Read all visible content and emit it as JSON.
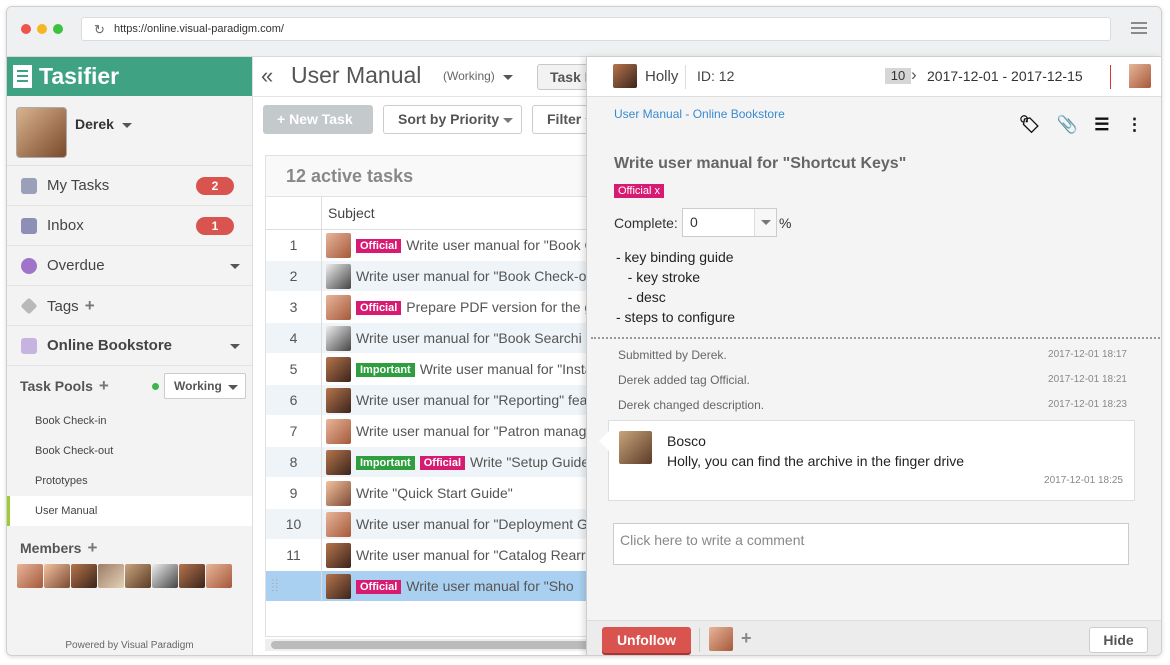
{
  "browser": {
    "url": "https://online.visual-paradigm.com/"
  },
  "sidebar": {
    "brand": "Tasifier",
    "user_name": "Derek",
    "items": [
      {
        "label": "My Tasks",
        "badge": "2",
        "icon": "my-tasks-icon"
      },
      {
        "label": "Inbox",
        "badge": "1",
        "icon": "inbox-icon"
      },
      {
        "label": "Overdue",
        "icon": "overdue-icon"
      },
      {
        "label": "Tags",
        "icon": "tag-icon"
      },
      {
        "label": "Online Bookstore",
        "icon": "project-icon"
      }
    ],
    "pools_label": "Task Pools",
    "pool_status": "Working",
    "pools": [
      "Book Check-in",
      "Book Check-out",
      "Prototypes",
      "User Manual"
    ],
    "active_pool": "User Manual",
    "members_label": "Members",
    "powered_by": "Powered by Visual Paradigm"
  },
  "main": {
    "title": "User Manual",
    "status": "(Working)",
    "task_button": "Task B",
    "new_task": "New Task",
    "sort": "Sort by Priority",
    "filter": "Filter",
    "active_count": "12 active tasks",
    "subject_header": "Subject",
    "rows": [
      {
        "num": "1",
        "tags": [
          "Official"
        ],
        "text": "Write user manual for \"Book C"
      },
      {
        "num": "2",
        "tags": [],
        "text": "Write user manual for \"Book Check-o"
      },
      {
        "num": "3",
        "tags": [
          "Official"
        ],
        "text": "Prepare PDF version for the g"
      },
      {
        "num": "4",
        "tags": [],
        "text": "Write user manual for \"Book Searchi"
      },
      {
        "num": "5",
        "tags": [
          "Important"
        ],
        "text": "Write user manual for \"Insta"
      },
      {
        "num": "6",
        "tags": [],
        "text": "Write user manual for \"Reporting\" fea"
      },
      {
        "num": "7",
        "tags": [],
        "text": "Write user manual for \"Patron manag"
      },
      {
        "num": "8",
        "tags": [
          "Important",
          "Official"
        ],
        "text": "Write \"Setup Guide"
      },
      {
        "num": "9",
        "tags": [],
        "text": "Write \"Quick Start Guide\""
      },
      {
        "num": "10",
        "tags": [],
        "text": "Write user manual for \"Deployment G"
      },
      {
        "num": "11",
        "tags": [],
        "text": "Write user manual for \"Catalog Rearr"
      },
      {
        "num": "",
        "tags": [
          "Official"
        ],
        "text": "Write user manual for \"Sho"
      }
    ]
  },
  "detail": {
    "assignee": "Holly",
    "id": "ID: 12",
    "priority": "10",
    "dates": "2017-12-01 - 2017-12-15",
    "breadcrumb": "User Manual - Online Bookstore",
    "title": "Write user manual for \"Shortcut Keys\"",
    "tag": "Official  x",
    "complete_label": "Complete:",
    "complete_value": "0",
    "percent": "%",
    "description": "- key binding guide\n   - key stroke\n   - desc\n- steps to configure",
    "log": [
      {
        "text": "Submitted by Derek.",
        "time": "2017-12-01 18:17"
      },
      {
        "text": "Derek added tag Official.",
        "time": "2017-12-01 18:21"
      },
      {
        "text": "Derek changed description.",
        "time": "2017-12-01 18:23"
      }
    ],
    "comment": {
      "author": "Bosco",
      "text": "Holly, you can find the archive in the finger drive",
      "time": "2017-12-01 18:25"
    },
    "comment_placeholder": "Click here to write a comment",
    "unfollow": "Unfollow",
    "hide": "Hide"
  },
  "colors": {
    "brand": "#3ea283",
    "badge": "#d9534f",
    "official": "#d81b72",
    "important": "#2e9e3e",
    "link": "#3a8ad0"
  }
}
